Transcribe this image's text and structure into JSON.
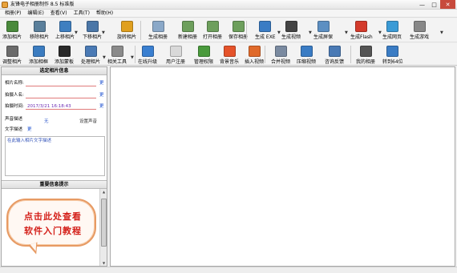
{
  "window": {
    "title": "友锋电子相册制作 8.5 标准版",
    "controls": [
      "—",
      "□",
      "✕"
    ]
  },
  "menu": [
    "相册(P)",
    "编辑(E)",
    "查看(V)",
    "工具(T)",
    "帮助(H)"
  ],
  "toolbar_row1": [
    {
      "label": "添加相片",
      "icon": "add-photo-icon",
      "color": "#4a8a3c"
    },
    {
      "label": "移除相片",
      "icon": "remove-photo-icon",
      "color": "#5a7f9b"
    },
    {
      "label": "上移相片",
      "icon": "move-up-photo-icon",
      "color": "#3f7fc0"
    },
    {
      "label": "下移相片",
      "icon": "move-down-photo-icon",
      "color": "#4b77a8"
    },
    {
      "label": "旋转相片",
      "icon": "rotate-photo-icon",
      "color": "#e0a020"
    },
    {
      "label": "生成相册",
      "icon": "generate-album-icon",
      "color": "#8aa8c8"
    },
    {
      "label": "新建相册",
      "icon": "new-album-icon",
      "color": "#6d9f5c"
    },
    {
      "label": "打开相册",
      "icon": "open-album-icon",
      "color": "#6d9f5c"
    },
    {
      "label": "保存相册",
      "icon": "save-album-icon",
      "color": "#6d9f5c"
    },
    {
      "label": "生成 EXE",
      "icon": "exe-icon",
      "color": "#3a7cc4"
    },
    {
      "label": "生成视频",
      "icon": "video-icon",
      "color": "#444444"
    },
    {
      "label": "生成屏保",
      "icon": "screensaver-icon",
      "color": "#5c8fc2"
    },
    {
      "label": "生成Flash",
      "icon": "flash-icon",
      "color": "#d33a2b"
    },
    {
      "label": "生成网页",
      "icon": "webpage-icon",
      "color": "#3b9bd6"
    },
    {
      "label": "生成游戏",
      "icon": "game-icon",
      "color": "#888888"
    }
  ],
  "toolbar_row2": [
    {
      "label": "调整相片",
      "icon": "adjust-photo-icon",
      "color": "#6b6b6b"
    },
    {
      "label": "添加相框",
      "icon": "add-frame-icon",
      "color": "#3b7cc0"
    },
    {
      "label": "添加蒙板",
      "icon": "add-mask-icon",
      "color": "#2a2a2a"
    },
    {
      "label": "处理相片",
      "icon": "process-photo-icon",
      "color": "#4a7ab5"
    },
    {
      "label": "相关工具",
      "icon": "tools-icon",
      "color": "#8a8a8a"
    },
    {
      "label": "在线升级",
      "icon": "online-upgrade-icon",
      "color": "#3a7fd0"
    },
    {
      "label": "用户注册",
      "icon": "user-register-icon",
      "color": "#d9d9d9"
    },
    {
      "label": "管理权限",
      "icon": "manage-permission-icon",
      "color": "#4a9a3c"
    },
    {
      "label": "背景音乐",
      "icon": "music-icon",
      "color": "#e5532a"
    },
    {
      "label": "插入视频",
      "icon": "insert-video-icon",
      "color": "#e06a2a"
    },
    {
      "label": "合并视频",
      "icon": "merge-video-icon",
      "color": "#7a8aa0"
    },
    {
      "label": "压缩视频",
      "icon": "compress-video-icon",
      "color": "#3a7cc4"
    },
    {
      "label": "咨询反馈",
      "icon": "feedback-icon",
      "color": "#4a7ab5"
    },
    {
      "label": "我的相册",
      "icon": "my-album-icon",
      "color": "#555555"
    },
    {
      "label": "转到64位",
      "icon": "switch-64-icon",
      "color": "#3a7cc4"
    }
  ],
  "left_panel": {
    "header": "选定相片信息",
    "fields": [
      {
        "label": "相片名称:",
        "value": "",
        "action": "更"
      },
      {
        "label": "拍摄人名:",
        "value": "",
        "action": "更"
      },
      {
        "label": "拍摄时间:",
        "value": "2017/3/21 16:18:43",
        "action": "更"
      }
    ],
    "voice_label": "声音描述",
    "voice_value": "无",
    "voice_set": "设置声音",
    "text_label": "文字描述",
    "text_action": "更",
    "textarea_text": "在此输入相片文字描述",
    "tips_header": "重要信息提示",
    "tip_lines": [
      "点击此处查看",
      "软件入门教程"
    ]
  }
}
